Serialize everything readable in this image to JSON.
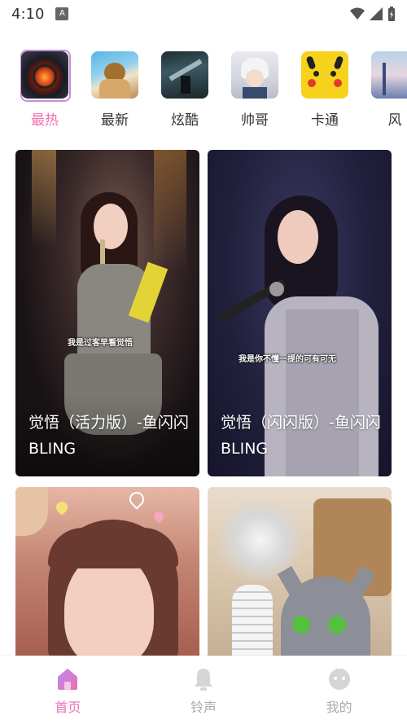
{
  "status_bar": {
    "time": "4:10",
    "notification_icon_label": "A"
  },
  "categories": [
    {
      "label": "最热",
      "active": true
    },
    {
      "label": "最新",
      "active": false
    },
    {
      "label": "炫酷",
      "active": false
    },
    {
      "label": "帅哥",
      "active": false
    },
    {
      "label": "卡通",
      "active": false
    },
    {
      "label": "风",
      "active": false
    }
  ],
  "cards": [
    {
      "title": "觉悟（活力版）-鱼闪闪BLING",
      "caption": "我是过客早看觉悟"
    },
    {
      "title": "觉悟（闪闪版）-鱼闪闪BLING",
      "caption": "我是你不懂一提的可有可无"
    },
    {
      "title": "",
      "caption": ""
    },
    {
      "title": "",
      "caption": ""
    }
  ],
  "bottom_nav": {
    "items": [
      {
        "label": "首页",
        "active": true
      },
      {
        "label": "铃声",
        "active": false
      },
      {
        "label": "我的",
        "active": false
      }
    ]
  },
  "colors": {
    "accent": "#f06eb0",
    "active_frame": "#c98cdc",
    "inactive": "#aaaaaa"
  }
}
